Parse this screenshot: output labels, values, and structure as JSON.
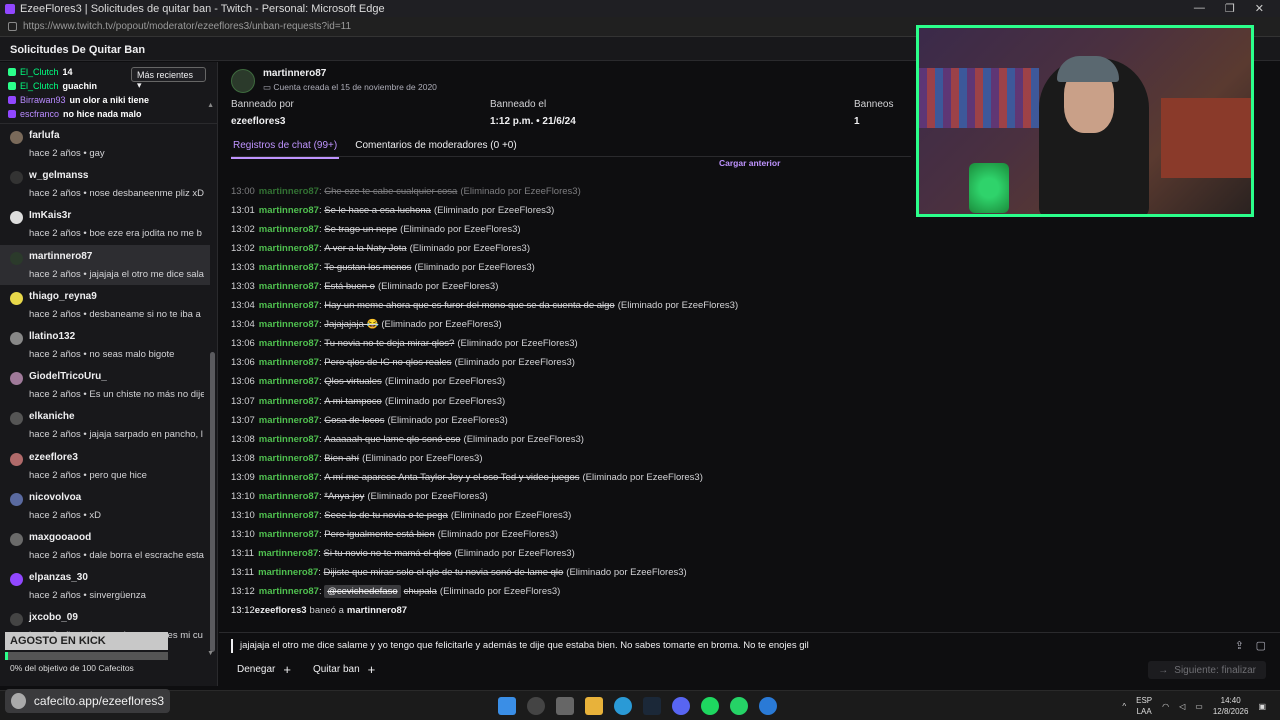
{
  "window": {
    "title": "EzeeFlores3 | Solicitudes de quitar ban - Twitch - Personal: Microsoft Edge",
    "url": "https://www.twitch.tv/popout/moderator/ezeeflores3/unban-requests?id=11",
    "controls": [
      "—",
      "❐",
      "✕"
    ]
  },
  "header": {
    "title": "Solicitudes De Quitar Ban"
  },
  "sidebar": {
    "sort_label": "Más recientes ▾",
    "overlay_chat": [
      {
        "name": "El_Clutch",
        "text": "14",
        "color": "#00ff7f"
      },
      {
        "name": "El_Clutch",
        "text": "guachin",
        "color": "#00ff7f"
      },
      {
        "name": "Birrawan93",
        "text": "un olor a niki tiene",
        "color": "#b98bff"
      },
      {
        "name": "escfranco",
        "text": "no hice nada malo",
        "color": "#b98bff"
      }
    ],
    "items": [
      {
        "user": "farlufa",
        "line": "hace 2 años • gay"
      },
      {
        "user": "w_gelmanss",
        "line": "hace 2 años • nose desbaneenme pliz xD"
      },
      {
        "user": "ImKais3r",
        "line": "hace 2 años • boe eze era jodita no me b"
      },
      {
        "user": "martinnero87",
        "line": "hace 2 años • jajajaja el otro me dice sala"
      },
      {
        "user": "thiago_reyna9",
        "line": "hace 2 años • desbaneame si no te iba a"
      },
      {
        "user": "llatino132",
        "line": "hace 2 años • no seas malo bigote"
      },
      {
        "user": "GiodelTricoUru_",
        "line": "hace 2 años • Es un chiste no más no dije"
      },
      {
        "user": "elkaniche",
        "line": "hace 2 años • jajaja sarpado en pancho, l"
      },
      {
        "user": "ezeeflore3",
        "line": "hace 2 años • pero que hice"
      },
      {
        "user": "nicovolvoa",
        "line": "hace 2 años • xD"
      },
      {
        "user": "maxgooaood",
        "line": "hace 2 años • dale borra el escrache esta"
      },
      {
        "user": "elpanzas_30",
        "line": "hace 2 años • sinvergüenza"
      },
      {
        "user": "jxcobo_09",
        "line": "hace 2 años • fracasado, oye no es mi cu"
      }
    ]
  },
  "user": {
    "name": "martinnero87",
    "created": "Cuenta creada el 15 de noviembre de 2020",
    "banned_by_label": "Banneado por",
    "banned_by": "ezeeflores3",
    "banned_at_label": "Banneado el",
    "banned_at": "1:12 p.m. • 21/6/24",
    "bans_label": "Banneos",
    "bans": "1"
  },
  "tabs": [
    {
      "label": "Registros de chat (99+)",
      "active": true
    },
    {
      "label": "Comentarios de moderadores (0 +0)",
      "active": false
    }
  ],
  "load_prev": "Cargar anterior",
  "chat_log": [
    {
      "t": "13:00",
      "m": "Che eze te cabe cualquier cosa"
    },
    {
      "t": "13:01",
      "m": "Se le hace a esa luchona"
    },
    {
      "t": "13:02",
      "m": "Se trago un nepe"
    },
    {
      "t": "13:02",
      "m": "A ver a la Naty Jota"
    },
    {
      "t": "13:03",
      "m": "Te gustan los menos"
    },
    {
      "t": "13:03",
      "m": "Está buen o"
    },
    {
      "t": "13:04",
      "m": "Hay un meme ahora que es furor del mono que se da cuenta de algo"
    },
    {
      "t": "13:04",
      "m": "Jajajajaja 😂"
    },
    {
      "t": "13:06",
      "m": "Tu novia no te deja mirar qlos?"
    },
    {
      "t": "13:06",
      "m": "Pero qlos de IC no qlos reales"
    },
    {
      "t": "13:06",
      "m": "Qlos virtuales"
    },
    {
      "t": "13:07",
      "m": "A mi tampoco"
    },
    {
      "t": "13:07",
      "m": "Cosa de locos"
    },
    {
      "t": "13:08",
      "m": "Aaaaaah que lame qlo sonó eso"
    },
    {
      "t": "13:08",
      "m": "Bien ahí"
    },
    {
      "t": "13:09",
      "m": "A mí me aparece Anta Taylor Joy y el oso Ted y video juegos"
    },
    {
      "t": "13:10",
      "m": "*Anya joy"
    },
    {
      "t": "13:10",
      "m": "Seee lo de tu novia o te pega"
    },
    {
      "t": "13:10",
      "m": "Pero igualmente está bien"
    },
    {
      "t": "13:11",
      "m": "Si tu novio no te mamá el qloo"
    },
    {
      "t": "13:11",
      "m": "Dijiste que miras solo el qlo de tu novia sonó de lame qlo"
    },
    {
      "t": "13:12",
      "mention": "@cevichedefaso",
      "m": "chupala"
    }
  ],
  "chat_user": "martinnero87",
  "deleted_label": "(Eliminado por EzeeFlores3)",
  "ban_event": {
    "t": "13:12",
    "actor": "ezeeflores3",
    "verb": "baneó a",
    "target": "martinnero87"
  },
  "request_text": "jajajaja el otro me dice salame y yo tengo que felicitarle y además te dije que estaba bien. No sabes tomarte en broma. No te enojes gil",
  "actions": {
    "deny": "Denegar",
    "unban": "Quitar ban",
    "next": "Siguiente: finalizar"
  },
  "overlay": {
    "kick_title": "AGOSTO EN KICK",
    "kick_progress": 0.0,
    "kick_sub": "0% del objetivo de 100 Cafecitos",
    "cafecito": "cafecito.app/ezeeflores3"
  },
  "taskbar": {
    "lang": "ESP",
    "lang2": "LAA",
    "time": "14:40",
    "date": "12/8/2026"
  }
}
